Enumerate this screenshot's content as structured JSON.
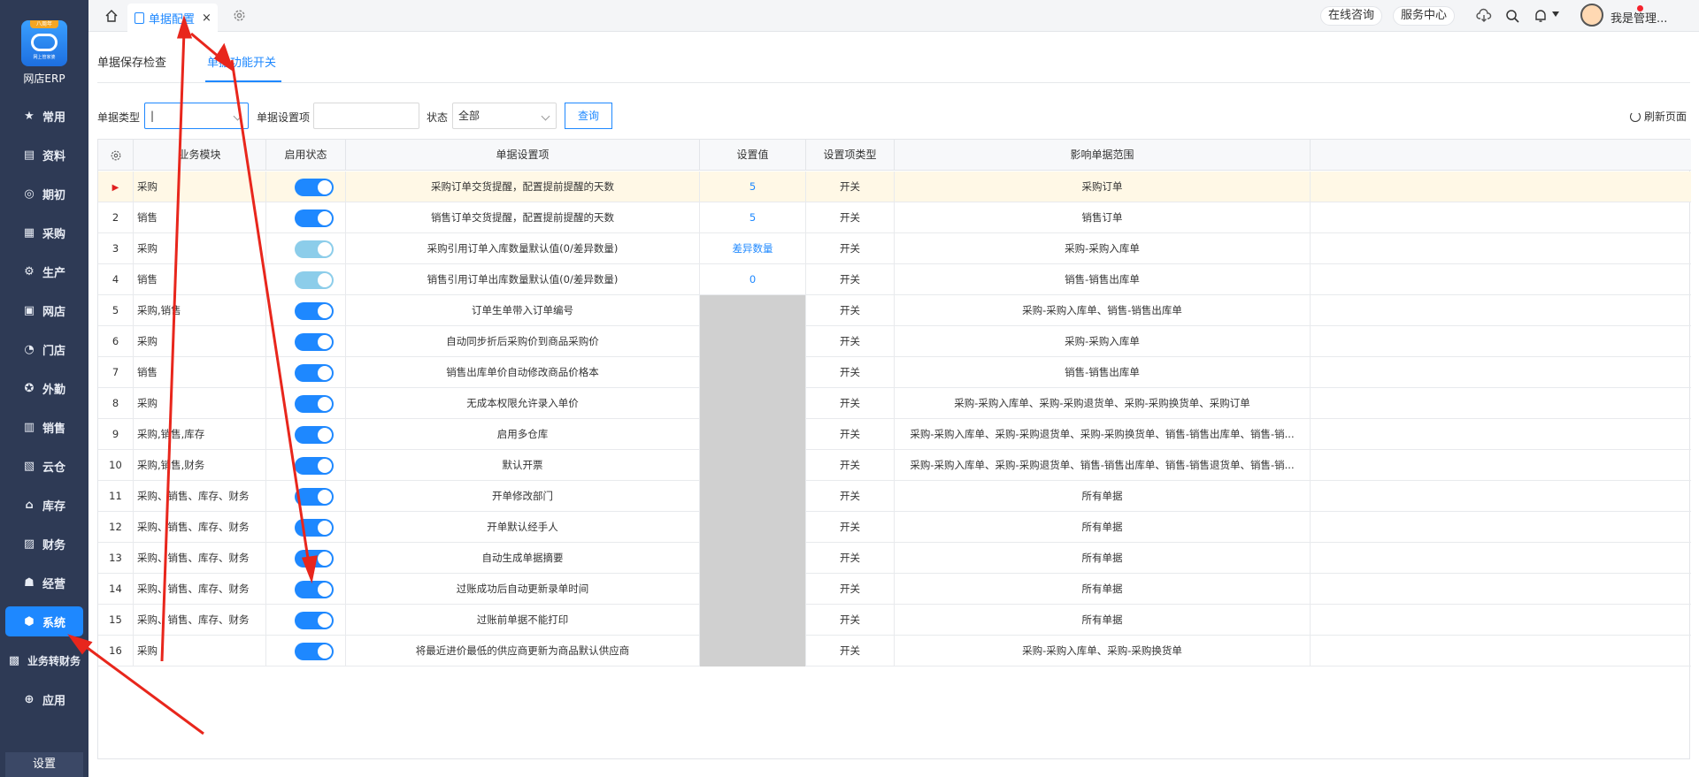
{
  "sidebar": {
    "logo_badge": "八周年",
    "logo_sub": "网上管家婆",
    "logo_text": "网店ERP",
    "items": [
      {
        "label": "常用",
        "icon": "star-icon"
      },
      {
        "label": "资料",
        "icon": "document-icon"
      },
      {
        "label": "期初",
        "icon": "target-icon"
      },
      {
        "label": "采购",
        "icon": "purchase-icon"
      },
      {
        "label": "生产",
        "icon": "production-icon"
      },
      {
        "label": "网店",
        "icon": "shop-icon"
      },
      {
        "label": "门店",
        "icon": "pie-icon"
      },
      {
        "label": "外勤",
        "icon": "compass-icon"
      },
      {
        "label": "销售",
        "icon": "bar-chart-icon"
      },
      {
        "label": "云仓",
        "icon": "warehouse-icon"
      },
      {
        "label": "库存",
        "icon": "house-icon"
      },
      {
        "label": "财务",
        "icon": "wallet-icon"
      },
      {
        "label": "经营",
        "icon": "thumb-icon"
      },
      {
        "label": "系统",
        "icon": "system-icon",
        "active": true
      },
      {
        "label": "业务转财务",
        "icon": "transfer-icon"
      },
      {
        "label": "应用",
        "icon": "plus-icon"
      }
    ],
    "settings_label": "设置"
  },
  "topbar": {
    "tab_label": "单据配置",
    "tab_close": "×",
    "online_consult": "在线咨询",
    "service_center": "服务中心",
    "user_name": "我是管理..."
  },
  "subtabs": [
    {
      "label": "单据保存检查",
      "active": false
    },
    {
      "label": "单据功能开关",
      "active": true
    }
  ],
  "filters": {
    "doc_type_label": "单据类型",
    "doc_type_value": "|",
    "setting_item_label": "单据设置项",
    "setting_item_value": "",
    "status_label": "状态",
    "status_value": "全部",
    "query_button": "查询",
    "refresh_label": "刷新页面"
  },
  "table": {
    "columns": [
      "业务模块",
      "启用状态",
      "单据设置项",
      "设置值",
      "设置项类型",
      "影响单据范围"
    ],
    "rows": [
      {
        "idx": "",
        "module": "采购",
        "enabled": true,
        "light": false,
        "name": "采购订单交货提醒，配置提前提醒的天数",
        "value": "5",
        "gray": false,
        "type": "开关",
        "scope": "采购订单",
        "selected": true
      },
      {
        "idx": "2",
        "module": "销售",
        "enabled": true,
        "light": false,
        "name": "销售订单交货提醒，配置提前提醒的天数",
        "value": "5",
        "gray": false,
        "type": "开关",
        "scope": "销售订单",
        "selected": false
      },
      {
        "idx": "3",
        "module": "采购",
        "enabled": true,
        "light": true,
        "name": "采购引用订单入库数量默认值(0/差异数量)",
        "value": "差异数量",
        "gray": false,
        "type": "开关",
        "scope": "采购-采购入库单",
        "selected": false
      },
      {
        "idx": "4",
        "module": "销售",
        "enabled": true,
        "light": true,
        "name": "销售引用订单出库数量默认值(0/差异数量)",
        "value": "0",
        "gray": false,
        "type": "开关",
        "scope": "销售-销售出库单",
        "selected": false
      },
      {
        "idx": "5",
        "module": "采购,销售",
        "enabled": true,
        "light": false,
        "name": "订单生单带入订单编号",
        "value": "",
        "gray": true,
        "type": "开关",
        "scope": "采购-采购入库单、销售-销售出库单",
        "selected": false
      },
      {
        "idx": "6",
        "module": "采购",
        "enabled": true,
        "light": false,
        "name": "自动同步折后采购价到商品采购价",
        "value": "",
        "gray": true,
        "type": "开关",
        "scope": "采购-采购入库单",
        "selected": false
      },
      {
        "idx": "7",
        "module": "销售",
        "enabled": true,
        "light": false,
        "name": "销售出库单价自动修改商品价格本",
        "value": "",
        "gray": true,
        "type": "开关",
        "scope": "销售-销售出库单",
        "selected": false
      },
      {
        "idx": "8",
        "module": "采购",
        "enabled": true,
        "light": false,
        "name": "无成本权限允许录入单价",
        "value": "",
        "gray": true,
        "type": "开关",
        "scope": "采购-采购入库单、采购-采购退货单、采购-采购换货单、采购订单",
        "selected": false
      },
      {
        "idx": "9",
        "module": "采购,销售,库存",
        "enabled": true,
        "light": false,
        "name": "启用多仓库",
        "value": "",
        "gray": true,
        "type": "开关",
        "scope": "采购-采购入库单、采购-采购退货单、采购-采购换货单、销售-销售出库单、销售-销...",
        "selected": false
      },
      {
        "idx": "10",
        "module": "采购,销售,财务",
        "enabled": true,
        "light": false,
        "name": "默认开票",
        "value": "",
        "gray": true,
        "type": "开关",
        "scope": "采购-采购入库单、采购-采购退货单、销售-销售出库单、销售-销售退货单、销售-销...",
        "selected": false
      },
      {
        "idx": "11",
        "module": "采购、销售、库存、财务",
        "enabled": true,
        "light": false,
        "name": "开单修改部门",
        "value": "",
        "gray": true,
        "type": "开关",
        "scope": "所有单据",
        "selected": false
      },
      {
        "idx": "12",
        "module": "采购、销售、库存、财务",
        "enabled": true,
        "light": false,
        "name": "开单默认经手人",
        "value": "",
        "gray": true,
        "type": "开关",
        "scope": "所有单据",
        "selected": false
      },
      {
        "idx": "13",
        "module": "采购、销售、库存、财务",
        "enabled": true,
        "light": false,
        "name": "自动生成单据摘要",
        "value": "",
        "gray": true,
        "type": "开关",
        "scope": "所有单据",
        "selected": false
      },
      {
        "idx": "14",
        "module": "采购、销售、库存、财务",
        "enabled": true,
        "light": false,
        "name": "过账成功后自动更新录单时间",
        "value": "",
        "gray": true,
        "type": "开关",
        "scope": "所有单据",
        "selected": false
      },
      {
        "idx": "15",
        "module": "采购、销售、库存、财务",
        "enabled": true,
        "light": false,
        "name": "过账前单据不能打印",
        "value": "",
        "gray": true,
        "type": "开关",
        "scope": "所有单据",
        "selected": false
      },
      {
        "idx": "16",
        "module": "采购",
        "enabled": true,
        "light": false,
        "name": "将最近进价最低的供应商更新为商品默认供应商",
        "value": "",
        "gray": true,
        "type": "开关",
        "scope": "采购-采购入库单、采购-采购换货单",
        "selected": false
      }
    ]
  },
  "colors": {
    "accent": "#1e88ff",
    "sidebar_bg": "#2e3a55",
    "annotation_red": "#e8261c",
    "toggle_light": "#8ccdea",
    "selected_row_bg": "#fff8e6"
  }
}
